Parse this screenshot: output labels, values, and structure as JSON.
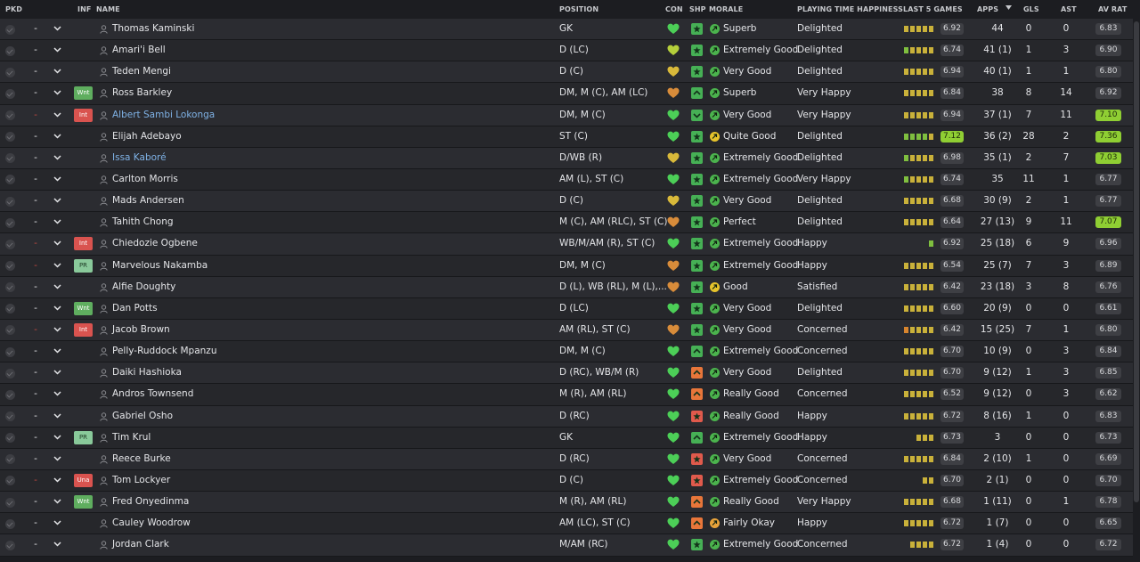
{
  "headers": {
    "pkd": "PKD",
    "inf": "INF",
    "name": "NAME",
    "position": "POSITION",
    "con": "CON",
    "shp": "SHP",
    "morale": "MORALE",
    "pth": "PLAYING TIME HAPPINESS",
    "last5": "LAST 5 GAMES",
    "apps": "APPS",
    "gls": "GLS",
    "ast": "AST",
    "avrat": "AV RAT"
  },
  "sort_indicator": "apps-descending",
  "colors": {
    "form_green": "#7fbf3f",
    "form_yellow": "#c9b13a",
    "form_orange": "#d8852e",
    "form_red": "#d64b3c",
    "highlight_rating": "#8fce33",
    "link_name": "#7fb2e6"
  },
  "players": [
    {
      "pkd": "-",
      "inf": "",
      "name": "Thomas Kaminski",
      "link": false,
      "position": "GK",
      "con": "green",
      "shp": "green",
      "shp_icon": "star",
      "mor_color": "green",
      "morale": "Superb",
      "pth": "Delighted",
      "form": [
        "y",
        "y",
        "y",
        "y",
        "y"
      ],
      "last5": "6.92",
      "last5_hi": false,
      "apps": "44",
      "gls": "0",
      "ast": "0",
      "avrat": "6.83",
      "avrat_hi": false
    },
    {
      "pkd": "-",
      "inf": "",
      "name": "Amari'i Bell",
      "link": false,
      "position": "D (LC)",
      "con": "yellow-green",
      "shp": "green",
      "shp_icon": "star",
      "mor_color": "green",
      "morale": "Extremely Good",
      "pth": "Delighted",
      "form": [
        "g",
        "y",
        "y",
        "y",
        "y"
      ],
      "last5": "6.74",
      "last5_hi": false,
      "apps": "41 (1)",
      "gls": "1",
      "ast": "3",
      "avrat": "6.90",
      "avrat_hi": false
    },
    {
      "pkd": "-",
      "inf": "",
      "name": "Teden Mengi",
      "link": false,
      "position": "D (C)",
      "con": "yellow",
      "shp": "green",
      "shp_icon": "star",
      "mor_color": "green",
      "morale": "Very Good",
      "pth": "Delighted",
      "form": [
        "y",
        "y",
        "y",
        "y",
        "y"
      ],
      "last5": "6.94",
      "last5_hi": false,
      "apps": "40 (1)",
      "gls": "1",
      "ast": "1",
      "avrat": "6.80",
      "avrat_hi": false
    },
    {
      "pkd": "-",
      "inf": "Wnt",
      "inf_color": "green",
      "name": "Ross Barkley",
      "link": false,
      "position": "DM, M (C), AM (LC)",
      "con": "orange",
      "shp": "green",
      "shp_icon": "up",
      "mor_color": "green",
      "morale": "Superb",
      "pth": "Very Happy",
      "form": [
        "y",
        "y",
        "y",
        "y",
        "y"
      ],
      "last5": "6.84",
      "last5_hi": false,
      "apps": "38",
      "gls": "8",
      "ast": "14",
      "avrat": "6.92",
      "avrat_hi": false
    },
    {
      "pkd": "-",
      "pkd_red": true,
      "inf": "Int",
      "inf_color": "red",
      "name": "Albert Sambi Lokonga",
      "link": true,
      "position": "DM, M (C)",
      "con": "green",
      "shp": "green",
      "shp_icon": "down",
      "mor_color": "green",
      "morale": "Very Good",
      "pth": "Very Happy",
      "form": [
        "y",
        "y",
        "y",
        "y",
        "y"
      ],
      "last5": "6.94",
      "last5_hi": false,
      "apps": "37 (1)",
      "gls": "7",
      "ast": "11",
      "avrat": "7.10",
      "avrat_hi": true
    },
    {
      "pkd": "-",
      "inf": "",
      "name": "Elijah Adebayo",
      "link": false,
      "position": "ST (C)",
      "con": "green",
      "shp": "green",
      "shp_icon": "star",
      "mor_color": "yellow",
      "morale": "Quite Good",
      "pth": "Delighted",
      "form": [
        "g",
        "g",
        "g",
        "g",
        "y"
      ],
      "last5": "7.12",
      "last5_hi": true,
      "apps": "36 (2)",
      "gls": "28",
      "ast": "2",
      "avrat": "7.36",
      "avrat_hi": true
    },
    {
      "pkd": "-",
      "inf": "",
      "name": "Issa Kaboré",
      "link": true,
      "position": "D/WB (R)",
      "con": "yellow",
      "shp": "green",
      "shp_icon": "star",
      "mor_color": "green",
      "morale": "Extremely Good",
      "pth": "Delighted",
      "form": [
        "g",
        "y",
        "y",
        "y",
        "y"
      ],
      "last5": "6.98",
      "last5_hi": false,
      "apps": "35 (1)",
      "gls": "2",
      "ast": "7",
      "avrat": "7.03",
      "avrat_hi": true
    },
    {
      "pkd": "-",
      "inf": "",
      "name": "Carlton Morris",
      "link": false,
      "position": "AM (L), ST (C)",
      "con": "green",
      "shp": "green",
      "shp_icon": "star",
      "mor_color": "green",
      "morale": "Extremely Good",
      "pth": "Very Happy",
      "form": [
        "g",
        "y",
        "y",
        "y",
        "y"
      ],
      "last5": "6.74",
      "last5_hi": false,
      "apps": "35",
      "gls": "11",
      "ast": "1",
      "avrat": "6.77",
      "avrat_hi": false
    },
    {
      "pkd": "-",
      "inf": "",
      "name": "Mads Andersen",
      "link": false,
      "position": "D (C)",
      "con": "yellow",
      "shp": "green",
      "shp_icon": "star",
      "mor_color": "green",
      "morale": "Very Good",
      "pth": "Delighted",
      "form": [
        "y",
        "y",
        "y",
        "y",
        "y"
      ],
      "last5": "6.68",
      "last5_hi": false,
      "apps": "30 (9)",
      "gls": "2",
      "ast": "1",
      "avrat": "6.77",
      "avrat_hi": false
    },
    {
      "pkd": "-",
      "inf": "",
      "name": "Tahith Chong",
      "link": false,
      "position": "M (C), AM (RLC), ST (C)",
      "con": "orange",
      "shp": "green",
      "shp_icon": "star",
      "mor_color": "green",
      "morale": "Perfect",
      "pth": "Delighted",
      "form": [
        "y",
        "y",
        "y",
        "y",
        "y"
      ],
      "last5": "6.64",
      "last5_hi": false,
      "apps": "27 (13)",
      "gls": "9",
      "ast": "11",
      "avrat": "7.07",
      "avrat_hi": true
    },
    {
      "pkd": "-",
      "pkd_red": true,
      "inf": "Int",
      "inf_color": "red",
      "name": "Chiedozie Ogbene",
      "link": false,
      "position": "WB/M/AM (R), ST (C)",
      "con": "green",
      "shp": "green",
      "shp_icon": "star",
      "mor_color": "green",
      "morale": "Extremely Good",
      "pth": "Happy",
      "form": [
        "g"
      ],
      "last5": "6.92",
      "last5_hi": false,
      "apps": "25 (18)",
      "gls": "6",
      "ast": "9",
      "avrat": "6.96",
      "avrat_hi": false
    },
    {
      "pkd": "-",
      "pkd_red": true,
      "inf": "PR",
      "inf_color": "ltgreen",
      "name": "Marvelous Nakamba",
      "link": false,
      "position": "DM, M (C)",
      "con": "orange",
      "shp": "green",
      "shp_icon": "star",
      "mor_color": "green",
      "morale": "Extremely Good",
      "pth": "Happy",
      "form": [
        "y",
        "y",
        "y",
        "y",
        "y"
      ],
      "last5": "6.54",
      "last5_hi": false,
      "apps": "25 (7)",
      "gls": "7",
      "ast": "3",
      "avrat": "6.89",
      "avrat_hi": false
    },
    {
      "pkd": "-",
      "inf": "",
      "name": "Alfie Doughty",
      "link": false,
      "position": "D (L), WB (RL), M (L),...",
      "con": "orange",
      "shp": "green",
      "shp_icon": "star",
      "mor_color": "yellow",
      "morale": "Good",
      "pth": "Satisfied",
      "form": [
        "y",
        "y",
        "y",
        "y",
        "y"
      ],
      "last5": "6.42",
      "last5_hi": false,
      "apps": "23 (18)",
      "gls": "3",
      "ast": "8",
      "avrat": "6.76",
      "avrat_hi": false
    },
    {
      "pkd": "-",
      "inf": "Wnt",
      "inf_color": "green",
      "name": "Dan Potts",
      "link": false,
      "position": "D (LC)",
      "con": "green",
      "shp": "green",
      "shp_icon": "star",
      "mor_color": "green",
      "morale": "Very Good",
      "pth": "Delighted",
      "form": [
        "y",
        "y",
        "y",
        "y",
        "y"
      ],
      "last5": "6.60",
      "last5_hi": false,
      "apps": "20 (9)",
      "gls": "0",
      "ast": "0",
      "avrat": "6.61",
      "avrat_hi": false
    },
    {
      "pkd": "-",
      "pkd_red": true,
      "inf": "Int",
      "inf_color": "red",
      "name": "Jacob Brown",
      "link": false,
      "position": "AM (RL), ST (C)",
      "con": "orange",
      "shp": "green",
      "shp_icon": "star",
      "mor_color": "green",
      "morale": "Very Good",
      "pth": "Concerned",
      "form": [
        "o",
        "y",
        "y",
        "y",
        "y"
      ],
      "last5": "6.42",
      "last5_hi": false,
      "apps": "15 (25)",
      "gls": "7",
      "ast": "1",
      "avrat": "6.80",
      "avrat_hi": false
    },
    {
      "pkd": "-",
      "inf": "",
      "name": "Pelly-Ruddock Mpanzu",
      "link": false,
      "position": "DM, M (C)",
      "con": "green",
      "shp": "green",
      "shp_icon": "up",
      "mor_color": "green",
      "morale": "Extremely Good",
      "pth": "Concerned",
      "form": [
        "y",
        "y",
        "y",
        "y",
        "y"
      ],
      "last5": "6.70",
      "last5_hi": false,
      "apps": "10 (9)",
      "gls": "0",
      "ast": "3",
      "avrat": "6.84",
      "avrat_hi": false
    },
    {
      "pkd": "-",
      "inf": "",
      "name": "Daiki Hashioka",
      "link": false,
      "position": "D (RC), WB/M (R)",
      "con": "green",
      "shp": "orange",
      "shp_icon": "up",
      "mor_color": "green",
      "morale": "Very Good",
      "pth": "Delighted",
      "form": [
        "y",
        "y",
        "y",
        "y",
        "y"
      ],
      "last5": "6.70",
      "last5_hi": false,
      "apps": "9 (12)",
      "gls": "1",
      "ast": "3",
      "avrat": "6.85",
      "avrat_hi": false
    },
    {
      "pkd": "-",
      "inf": "",
      "name": "Andros Townsend",
      "link": false,
      "position": "M (R), AM (RL)",
      "con": "green",
      "shp": "orange",
      "shp_icon": "up",
      "mor_color": "green",
      "morale": "Really Good",
      "pth": "Concerned",
      "form": [
        "y",
        "y",
        "y",
        "y",
        "y"
      ],
      "last5": "6.52",
      "last5_hi": false,
      "apps": "9 (12)",
      "gls": "0",
      "ast": "3",
      "avrat": "6.62",
      "avrat_hi": false
    },
    {
      "pkd": "-",
      "inf": "",
      "name": "Gabriel Osho",
      "link": false,
      "position": "D (RC)",
      "con": "green",
      "shp": "red",
      "shp_icon": "star",
      "mor_color": "green",
      "morale": "Really Good",
      "pth": "Happy",
      "form": [
        "y",
        "y",
        "y",
        "y",
        "y"
      ],
      "last5": "6.72",
      "last5_hi": false,
      "apps": "8 (16)",
      "gls": "1",
      "ast": "0",
      "avrat": "6.83",
      "avrat_hi": false
    },
    {
      "pkd": "-",
      "inf": "PR",
      "inf_color": "ltgreen",
      "name": "Tim Krul",
      "link": false,
      "position": "GK",
      "con": "green",
      "shp": "green",
      "shp_icon": "up",
      "mor_color": "green",
      "morale": "Extremely Good",
      "pth": "Happy",
      "form": [
        "y",
        "y",
        "y"
      ],
      "last5": "6.73",
      "last5_hi": false,
      "apps": "3",
      "gls": "0",
      "ast": "0",
      "avrat": "6.73",
      "avrat_hi": false
    },
    {
      "pkd": "-",
      "inf": "",
      "name": "Reece Burke",
      "link": false,
      "position": "D (RC)",
      "con": "green",
      "shp": "red",
      "shp_icon": "star",
      "mor_color": "green",
      "morale": "Very Good",
      "pth": "Concerned",
      "form": [
        "y",
        "y",
        "y",
        "y",
        "y"
      ],
      "last5": "6.84",
      "last5_hi": false,
      "apps": "2 (10)",
      "gls": "1",
      "ast": "0",
      "avrat": "6.69",
      "avrat_hi": false
    },
    {
      "pkd": "-",
      "pkd_red": true,
      "inf": "Una",
      "inf_color": "red",
      "name": "Tom Lockyer",
      "link": false,
      "position": "D (C)",
      "con": "green",
      "shp": "red",
      "shp_icon": "star",
      "mor_color": "green",
      "morale": "Extremely Good",
      "pth": "Concerned",
      "form": [
        "y",
        "y"
      ],
      "last5": "6.70",
      "last5_hi": false,
      "apps": "2 (1)",
      "gls": "0",
      "ast": "0",
      "avrat": "6.70",
      "avrat_hi": false
    },
    {
      "pkd": "-",
      "inf": "Wnt",
      "inf_color": "green",
      "name": "Fred Onyedinma",
      "link": false,
      "position": "M (R), AM (RL)",
      "con": "green",
      "shp": "orange",
      "shp_icon": "up",
      "mor_color": "green",
      "morale": "Really Good",
      "pth": "Very Happy",
      "form": [
        "y",
        "y",
        "y",
        "y",
        "y"
      ],
      "last5": "6.68",
      "last5_hi": false,
      "apps": "1 (11)",
      "gls": "0",
      "ast": "1",
      "avrat": "6.78",
      "avrat_hi": false
    },
    {
      "pkd": "-",
      "inf": "",
      "name": "Cauley Woodrow",
      "link": false,
      "position": "AM (LC), ST (C)",
      "con": "green",
      "shp": "orange",
      "shp_icon": "up",
      "mor_color": "orange",
      "morale": "Fairly Okay",
      "pth": "Happy",
      "form": [
        "y",
        "y",
        "y",
        "y",
        "y"
      ],
      "last5": "6.72",
      "last5_hi": false,
      "apps": "1 (7)",
      "gls": "0",
      "ast": "0",
      "avrat": "6.65",
      "avrat_hi": false
    },
    {
      "pkd": "-",
      "inf": "",
      "name": "Jordan Clark",
      "link": false,
      "position": "M/AM (RC)",
      "con": "green",
      "shp": "green",
      "shp_icon": "star",
      "mor_color": "green",
      "morale": "Extremely Good",
      "pth": "Concerned",
      "form": [
        "y",
        "y",
        "y",
        "y"
      ],
      "last5": "6.72",
      "last5_hi": false,
      "apps": "1 (4)",
      "gls": "0",
      "ast": "0",
      "avrat": "6.72",
      "avrat_hi": false
    }
  ]
}
